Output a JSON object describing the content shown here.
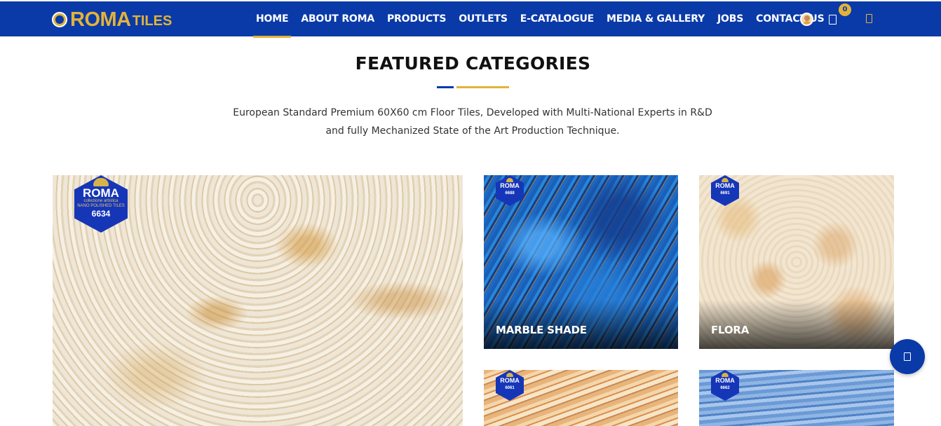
{
  "brand": {
    "logo_main": "ROMA",
    "logo_sub": "TILES"
  },
  "nav": {
    "items": [
      {
        "label": "HOME",
        "active": true
      },
      {
        "label": "ABOUT ROMA",
        "active": false
      },
      {
        "label": "PRODUCTS",
        "active": false
      },
      {
        "label": "OUTLETS",
        "active": false
      },
      {
        "label": "E-CATALOGUE",
        "active": false
      },
      {
        "label": "MEDIA & GALLERY",
        "active": false
      },
      {
        "label": "JOBS",
        "active": false
      },
      {
        "label": "CONTACT US",
        "active": false
      }
    ],
    "cart_count": "0",
    "icons": [
      "user-avatar-icon",
      "cart-icon",
      "wishlist-icon"
    ]
  },
  "section": {
    "title": "FEATURED CATEGORIES",
    "description_line1": "European Standard Premium 60X60 cm Floor Tiles, Developed with Multi-National Experts in R&D",
    "description_line2": "and fully Mechanized State of the Art Production Technique."
  },
  "cards": {
    "big": {
      "badge_brand": "ROMA",
      "badge_tag": "collezione artistica",
      "badge_sub": "NANO POLISHED TILES",
      "badge_num": "6634"
    },
    "marble": {
      "label": "MARBLE SHADE",
      "badge_brand": "ROMA",
      "badge_num": "6688"
    },
    "flora": {
      "label": "FLORA",
      "badge_brand": "ROMA",
      "badge_num": "6691"
    },
    "sand": {
      "badge_brand": "ROMA",
      "badge_num": "6061"
    },
    "aqua": {
      "badge_brand": "ROMA",
      "badge_num": "6662"
    }
  },
  "colors": {
    "primary": "#0a3aa8",
    "accent": "#e2b33a"
  }
}
